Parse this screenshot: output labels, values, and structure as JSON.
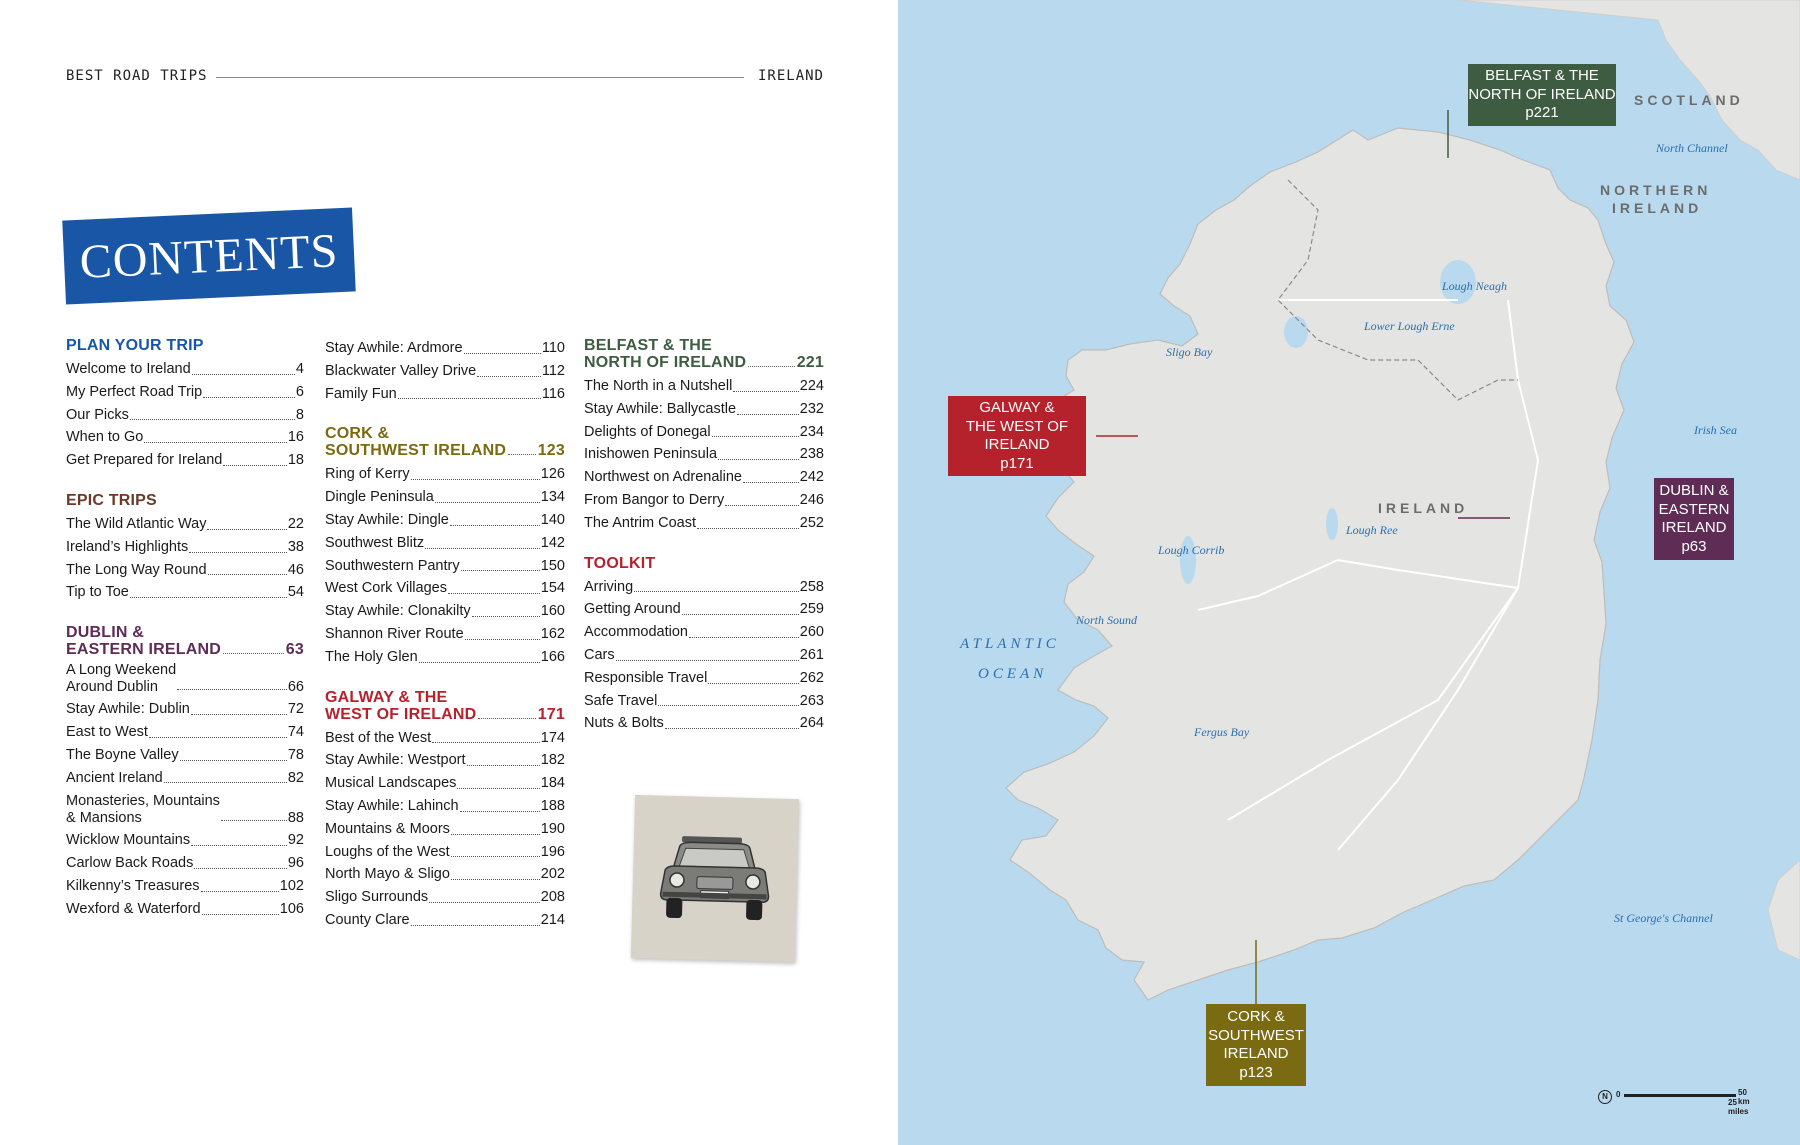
{
  "header": {
    "left": "BEST ROAD TRIPS",
    "right": "IRELAND"
  },
  "contents_title": "CONTENTS",
  "columns": [
    [
      {
        "type": "head",
        "color": "blue",
        "text": "PLAN YOUR TRIP",
        "page": ""
      },
      {
        "type": "entry",
        "title": "Welcome to Ireland",
        "page": "4"
      },
      {
        "type": "entry",
        "title": "My Perfect Road Trip",
        "page": "6"
      },
      {
        "type": "entry",
        "title": "Our Picks",
        "page": "8"
      },
      {
        "type": "entry",
        "title": "When to Go",
        "page": "16"
      },
      {
        "type": "entry",
        "title": "Get Prepared for Ireland",
        "page": "18"
      },
      {
        "type": "head",
        "color": "brown",
        "text": "EPIC TRIPS",
        "page": ""
      },
      {
        "type": "entry",
        "title": "The Wild Atlantic Way",
        "page": "22"
      },
      {
        "type": "entry",
        "title": "Ireland’s Highlights",
        "page": "38"
      },
      {
        "type": "entry",
        "title": "The Long Way Round",
        "page": "46"
      },
      {
        "type": "entry",
        "title": "Tip to Toe",
        "page": "54"
      },
      {
        "type": "head",
        "color": "purple",
        "text": "DUBLIN &\nEASTERN IRELAND",
        "page": "63"
      },
      {
        "type": "entry",
        "title": "A Long Weekend\nAround Dublin",
        "page": "66"
      },
      {
        "type": "entry",
        "title": "Stay Awhile: Dublin",
        "page": "72"
      },
      {
        "type": "entry",
        "title": "East to West",
        "page": "74"
      },
      {
        "type": "entry",
        "title": "The Boyne Valley",
        "page": "78"
      },
      {
        "type": "entry",
        "title": "Ancient Ireland",
        "page": "82"
      },
      {
        "type": "entry",
        "title": "Monasteries, Mountains\n& Mansions",
        "page": "88"
      },
      {
        "type": "entry",
        "title": "Wicklow Mountains",
        "page": "92"
      },
      {
        "type": "entry",
        "title": "Carlow Back Roads",
        "page": "96"
      },
      {
        "type": "entry",
        "title": "Kilkenny’s Treasures",
        "page": "102"
      },
      {
        "type": "entry",
        "title": "Wexford & Waterford",
        "page": "106"
      }
    ],
    [
      {
        "type": "entry",
        "title": "Stay Awhile: Ardmore",
        "page": "110"
      },
      {
        "type": "entry",
        "title": "Blackwater Valley Drive",
        "page": "112"
      },
      {
        "type": "entry",
        "title": "Family Fun",
        "page": "116"
      },
      {
        "type": "head",
        "color": "olive",
        "text": "CORK &\nSOUTHWEST IRELAND",
        "page": "123"
      },
      {
        "type": "entry",
        "title": "Ring of Kerry",
        "page": "126"
      },
      {
        "type": "entry",
        "title": "Dingle Peninsula",
        "page": "134"
      },
      {
        "type": "entry",
        "title": "Stay Awhile: Dingle",
        "page": "140"
      },
      {
        "type": "entry",
        "title": "Southwest Blitz",
        "page": "142"
      },
      {
        "type": "entry",
        "title": "Southwestern Pantry",
        "page": "150"
      },
      {
        "type": "entry",
        "title": "West Cork Villages",
        "page": "154"
      },
      {
        "type": "entry",
        "title": "Stay Awhile: Clonakilty",
        "page": "160"
      },
      {
        "type": "entry",
        "title": "Shannon River Route",
        "page": "162"
      },
      {
        "type": "entry",
        "title": "The Holy Glen",
        "page": "166"
      },
      {
        "type": "head",
        "color": "red",
        "text": "GALWAY & THE\nWEST OF IRELAND",
        "page": "171"
      },
      {
        "type": "entry",
        "title": "Best of the West",
        "page": "174"
      },
      {
        "type": "entry",
        "title": "Stay Awhile: Westport",
        "page": "182"
      },
      {
        "type": "entry",
        "title": "Musical Landscapes",
        "page": "184"
      },
      {
        "type": "entry",
        "title": "Stay Awhile: Lahinch",
        "page": "188"
      },
      {
        "type": "entry",
        "title": "Mountains & Moors",
        "page": "190"
      },
      {
        "type": "entry",
        "title": "Loughs of the West",
        "page": "196"
      },
      {
        "type": "entry",
        "title": "North Mayo & Sligo",
        "page": "202"
      },
      {
        "type": "entry",
        "title": "Sligo Surrounds",
        "page": "208"
      },
      {
        "type": "entry",
        "title": "County Clare",
        "page": "214"
      }
    ],
    [
      {
        "type": "head",
        "color": "green",
        "text": "BELFAST & THE\nNORTH OF IRELAND",
        "page": "221"
      },
      {
        "type": "entry",
        "title": "The North in a Nutshell",
        "page": "224"
      },
      {
        "type": "entry",
        "title": "Stay Awhile: Ballycastle",
        "page": "232"
      },
      {
        "type": "entry",
        "title": "Delights of Donegal",
        "page": "234"
      },
      {
        "type": "entry",
        "title": "Inishowen Peninsula",
        "page": "238"
      },
      {
        "type": "entry",
        "title": "Northwest on Adrenaline",
        "page": "242"
      },
      {
        "type": "entry",
        "title": "From Bangor to Derry",
        "page": "246"
      },
      {
        "type": "entry",
        "title": "The Antrim Coast",
        "page": "252"
      },
      {
        "type": "head",
        "color": "red",
        "text": "TOOLKIT",
        "page": ""
      },
      {
        "type": "entry",
        "title": "Arriving",
        "page": "258"
      },
      {
        "type": "entry",
        "title": "Getting Around",
        "page": "259"
      },
      {
        "type": "entry",
        "title": "Accommodation",
        "page": "260"
      },
      {
        "type": "entry",
        "title": "Cars",
        "page": "261"
      },
      {
        "type": "entry",
        "title": "Responsible Travel",
        "page": "262"
      },
      {
        "type": "entry",
        "title": "Safe Travel",
        "page": "263"
      },
      {
        "type": "entry",
        "title": "Nuts & Bolts",
        "page": "264"
      }
    ]
  ],
  "colors": {
    "blue": "#1a56a6",
    "brown": "#6b3a29",
    "purple": "#5e2c55",
    "olive": "#7a6a12",
    "red": "#b5222c",
    "green": "#3e5c42",
    "sea": "#b9d9ee",
    "land": "#e4e4e2"
  },
  "map": {
    "callouts": {
      "belfast": {
        "text": "BELFAST & THE\nNORTH OF IRELAND\np221",
        "color": "#3e5c42"
      },
      "galway": {
        "text": "GALWAY &\nTHE WEST OF\nIRELAND\np171",
        "color": "#b5222c"
      },
      "dublin": {
        "text": "DUBLIN &\nEASTERN\nIRELAND\np63",
        "color": "#5e2c55"
      },
      "cork": {
        "text": "CORK &\nSOUTHWEST\nIRELAND\np123",
        "color": "#7a6a12"
      }
    },
    "countries": [
      "SCOTLAND",
      "NORTHERN",
      "IRELAND",
      "IRELAND"
    ],
    "seas": [
      "ATLANTIC",
      "OCEAN"
    ],
    "waters": [
      "North\nChannel",
      "Irish\nSea",
      "St George's\nChannel",
      "Sligo\nBay",
      "Lough\nNeagh",
      "Lower\nLough\nErne",
      "Lough\nCorrib",
      "Lough\nRee",
      "North\nSound",
      "Fergus\nBay"
    ],
    "scale": {
      "km": "50 km",
      "miles": "25 miles",
      "zero": "0"
    }
  }
}
